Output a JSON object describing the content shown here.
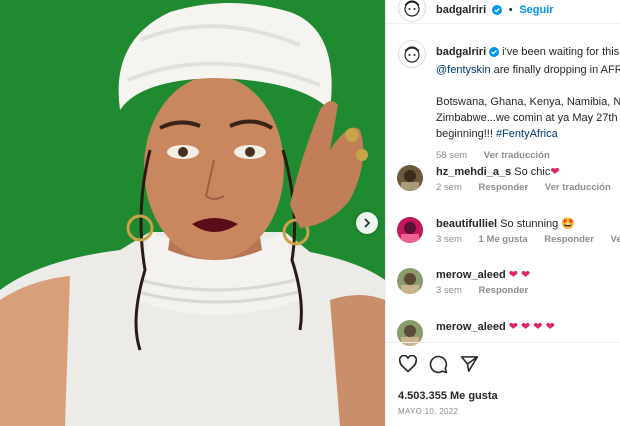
{
  "post": {
    "author": "badgalriri",
    "follow_label": "Seguir",
    "separator": "•"
  },
  "caption": {
    "author": "badgalriri",
    "line1_text": " i've been waiting for this",
    "line2_mention": "@fentyskin",
    "line2_text": " are finally dropping in AFR",
    "line3": "Botswana, Ghana, Kenya, Namibia, Nig",
    "line4": "Zimbabwe...we comin at ya May 27th",
    "line5_text": "beginning!!! ",
    "line5_tag": "#FentyAfrica",
    "age": "58 sem",
    "see_translation": "Ver traducción"
  },
  "comments": [
    {
      "user": "hz_mehdi_a_s",
      "text": " So chic",
      "emoji": "❤",
      "age": "2 sem",
      "reply": "Responder",
      "translate": "Ver traducción"
    },
    {
      "user": "beautifulliel",
      "text": " So stunning",
      "emoji": "🤩",
      "age": "3 sem",
      "likes": "1 Me gusta",
      "reply": "Responder",
      "translate": "Ver tradu"
    },
    {
      "user": "merow_aleed",
      "text": " ",
      "emoji": "❤ ❤",
      "age": "3 sem",
      "reply": "Responder"
    },
    {
      "user": "merow_aleed",
      "text": " ",
      "emoji": "❤ ❤ ❤ ❤"
    }
  ],
  "footer": {
    "likes": "4.503.355 Me gusta",
    "date": "MAYO 10, 2022"
  },
  "colors": {
    "background_green": "#1f8a2f",
    "link_blue": "#0095f6",
    "heart_red": "#e0245e",
    "secondary_text": "#8e8e8e"
  },
  "icons": {
    "like": "heart-outline-icon",
    "comment": "speech-bubble-icon",
    "share": "paper-plane-icon",
    "verified": "verified-badge-icon",
    "next": "chevron-right-icon"
  }
}
